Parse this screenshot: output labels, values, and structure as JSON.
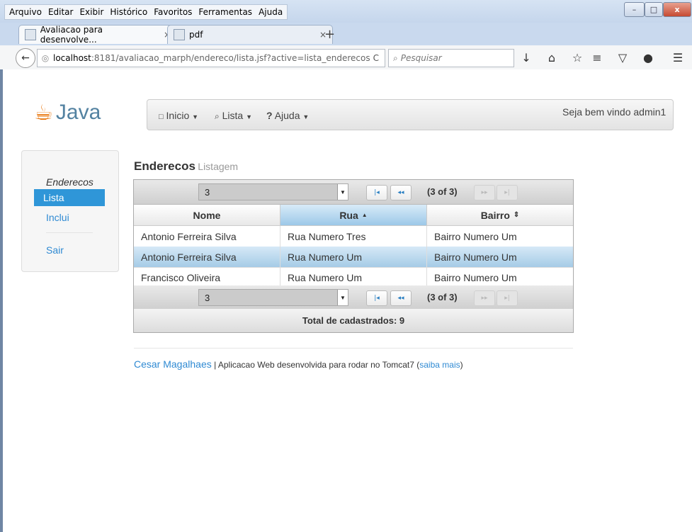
{
  "browser": {
    "menu": [
      "Arquivo",
      "Editar",
      "Exibir",
      "Histórico",
      "Favoritos",
      "Ferramentas",
      "Ajuda"
    ],
    "menu_accel": [
      "A",
      "E",
      "x",
      "H",
      "v",
      "F",
      "A"
    ],
    "window_buttons": {
      "minimize": "–",
      "maximize": "□",
      "close": "x"
    },
    "tabs": [
      {
        "label": "Avaliacao para desenvolve...",
        "close": "×"
      },
      {
        "label": "pdf",
        "close": "×"
      }
    ],
    "new_tab": "+",
    "url_host": "localhost",
    "url_path": ":8181/avaliacao_marph/endereco/lista.jsf?active=lista_enderecos",
    "reload": "C",
    "search_placeholder": "Pesquisar"
  },
  "app": {
    "logo_text": "Java",
    "menu": [
      {
        "label": "Inicio"
      },
      {
        "label": "Lista"
      },
      {
        "label": "Ajuda"
      }
    ],
    "welcome": "Seja bem vindo admin1",
    "sidebar": {
      "header": "Enderecos",
      "items": [
        {
          "label": "Lista",
          "active": true
        },
        {
          "label": "Inclui",
          "active": false
        }
      ],
      "logout": "Sair"
    },
    "heading": {
      "title": "Enderecos",
      "subtitle": "Listagem"
    },
    "table": {
      "rows_per_page": "3",
      "page_info": "(3 of 3)",
      "columns": [
        {
          "label": "Nome",
          "sort": ""
        },
        {
          "label": "Rua",
          "sort": "▲"
        },
        {
          "label": "Bairro",
          "sort": "⇕"
        }
      ],
      "rows": [
        {
          "nome": "Antonio Ferreira Silva",
          "rua": "Rua Numero Tres",
          "bairro": "Bairro Numero Um",
          "highlight": false
        },
        {
          "nome": "Antonio Ferreira Silva",
          "rua": "Rua Numero Um",
          "bairro": "Bairro Numero Um",
          "highlight": true
        },
        {
          "nome": "Francisco Oliveira",
          "rua": "Rua Numero Um",
          "bairro": "Bairro Numero Um",
          "highlight": false
        }
      ],
      "total": "Total de cadastrados: 9"
    },
    "footer": {
      "author": "Cesar Magalhaes",
      "separator": " | ",
      "text": "Aplicacao Web desenvolvida para rodar no Tomcat7 (",
      "link": "saiba mais",
      "close": ")"
    }
  }
}
